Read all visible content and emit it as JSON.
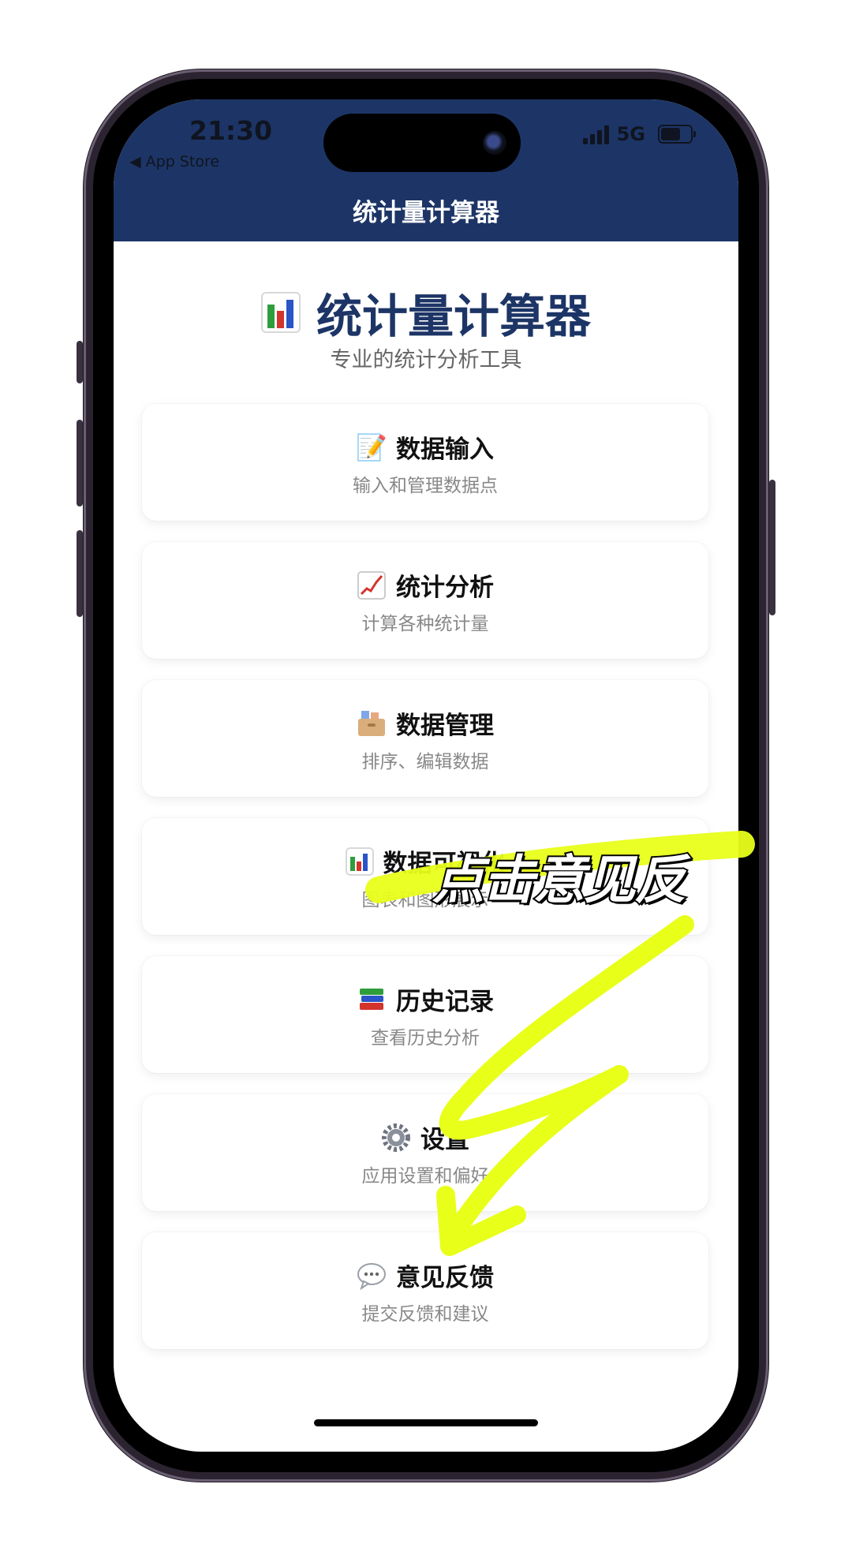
{
  "status_bar": {
    "time": "21:30",
    "back_label": "◀ App Store",
    "network": "5G"
  },
  "nav": {
    "title": "统计量计算器"
  },
  "header": {
    "title": "统计量计算器",
    "subtitle": "专业的统计分析工具"
  },
  "menu": [
    {
      "icon": "memo-icon",
      "title": "数据输入",
      "desc": "输入和管理数据点"
    },
    {
      "icon": "chart-increasing-icon",
      "title": "统计分析",
      "desc": "计算各种统计量"
    },
    {
      "icon": "card-file-box-icon",
      "title": "数据管理",
      "desc": "排序、编辑数据"
    },
    {
      "icon": "bar-chart-icon",
      "title": "数据可视化",
      "desc": "图表和图形展示"
    },
    {
      "icon": "books-icon",
      "title": "历史记录",
      "desc": "查看历史分析"
    },
    {
      "icon": "gear-icon",
      "title": "设置",
      "desc": "应用设置和偏好"
    },
    {
      "icon": "speech-bubble-icon",
      "title": "意见反馈",
      "desc": "提交反馈和建议"
    }
  ],
  "annotation": {
    "text": "点击意见反",
    "color": "#e8ff1a"
  }
}
